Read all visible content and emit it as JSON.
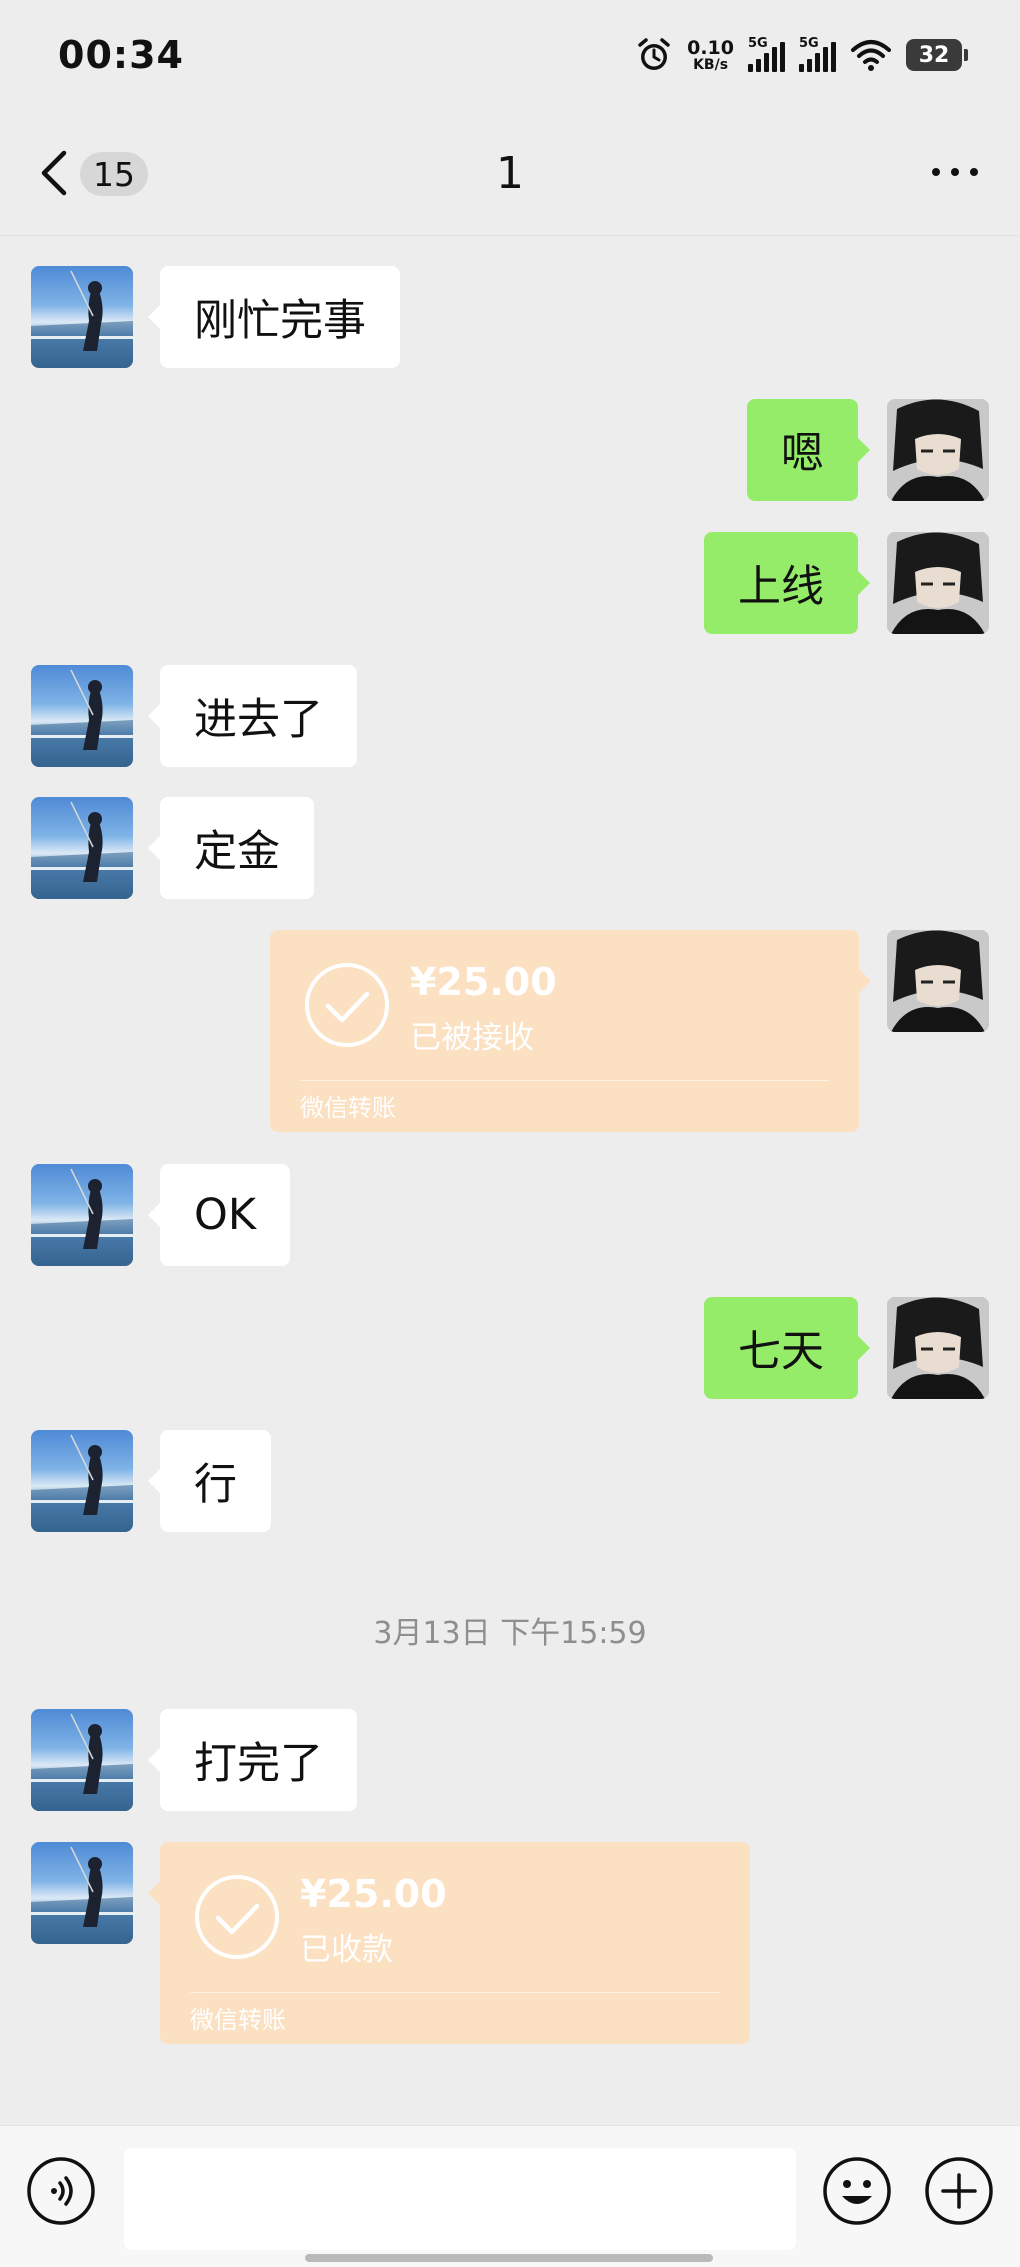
{
  "status_bar": {
    "time": "00:34",
    "net_speed_value": "0.10",
    "net_speed_unit": "KB/s",
    "sim1_label": "5G",
    "sim2_label": "5G",
    "battery": "32",
    "icons": [
      "alarm-icon",
      "signal-icon",
      "signal-icon",
      "wifi-icon",
      "battery-icon"
    ]
  },
  "nav": {
    "unread_count": "15",
    "title": "1",
    "icons": [
      "back-arrow-icon",
      "more-icon"
    ]
  },
  "messages": [
    {
      "side": "other",
      "type": "text",
      "text": "刚忙完事"
    },
    {
      "side": "self",
      "type": "text",
      "text": "嗯"
    },
    {
      "side": "self",
      "type": "text",
      "text": "上线"
    },
    {
      "side": "other",
      "type": "text",
      "text": "进去了"
    },
    {
      "side": "other",
      "type": "text",
      "text": "定金"
    },
    {
      "side": "self",
      "type": "transfer",
      "amount": "¥25.00",
      "status": "已被接收",
      "label": "微信转账"
    },
    {
      "side": "other",
      "type": "text",
      "text": "OK"
    },
    {
      "side": "self",
      "type": "text",
      "text": "七天"
    },
    {
      "side": "other",
      "type": "text",
      "text": "行"
    },
    {
      "type": "timestamp",
      "text": "3月13日 下午15:59"
    },
    {
      "side": "other",
      "type": "text",
      "text": "打完了"
    },
    {
      "side": "other",
      "type": "transfer",
      "amount": "¥25.00",
      "status": "已收款",
      "label": "微信转账"
    }
  ],
  "input_bar": {
    "placeholder": "",
    "icons": [
      "voice-icon",
      "emoji-icon",
      "plus-icon"
    ]
  },
  "colors": {
    "background": "#ededed",
    "self_bubble": "#95ec69",
    "other_bubble": "#ffffff",
    "transfer_card": "#fbe0c2"
  }
}
